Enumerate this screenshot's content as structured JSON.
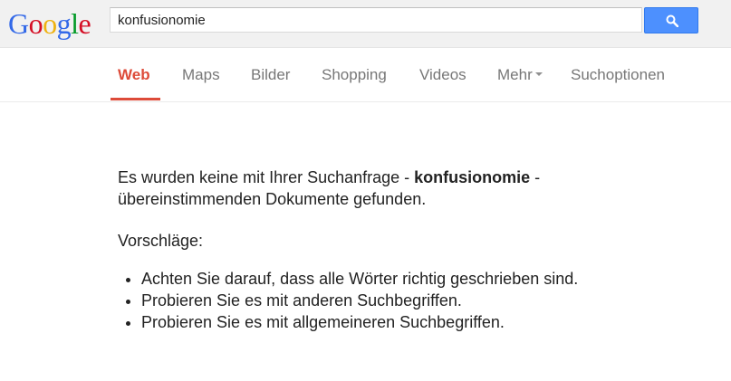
{
  "logo": {
    "letters": [
      "G",
      "o",
      "o",
      "g",
      "l",
      "e"
    ],
    "colors": [
      "#3369e8",
      "#d50f25",
      "#eeb211",
      "#3369e8",
      "#009925",
      "#d50f25"
    ]
  },
  "search": {
    "value": "konfusionomie",
    "button_icon": "search-icon"
  },
  "tabs": [
    {
      "label": "Web"
    },
    {
      "label": "Maps"
    },
    {
      "label": "Bilder"
    },
    {
      "label": "Shopping"
    },
    {
      "label": "Videos"
    },
    {
      "label": "Mehr"
    },
    {
      "label": "Suchoptionen"
    }
  ],
  "result": {
    "message_pre": "Es wurden keine mit Ihrer Suchanfrage - ",
    "query": "konfusionomie",
    "message_post": " - übereinstimmenden Dokumente gefunden.",
    "suggestions_title": "Vorschläge:",
    "suggestions": [
      "Achten Sie darauf, dass alle Wörter richtig geschrieben sind.",
      "Probieren Sie es mit anderen Suchbegriffen.",
      "Probieren Sie es mit allgemeineren Suchbegriffen."
    ]
  },
  "colors": {
    "accent": "#dd4b39",
    "button": "#4d90fe"
  }
}
